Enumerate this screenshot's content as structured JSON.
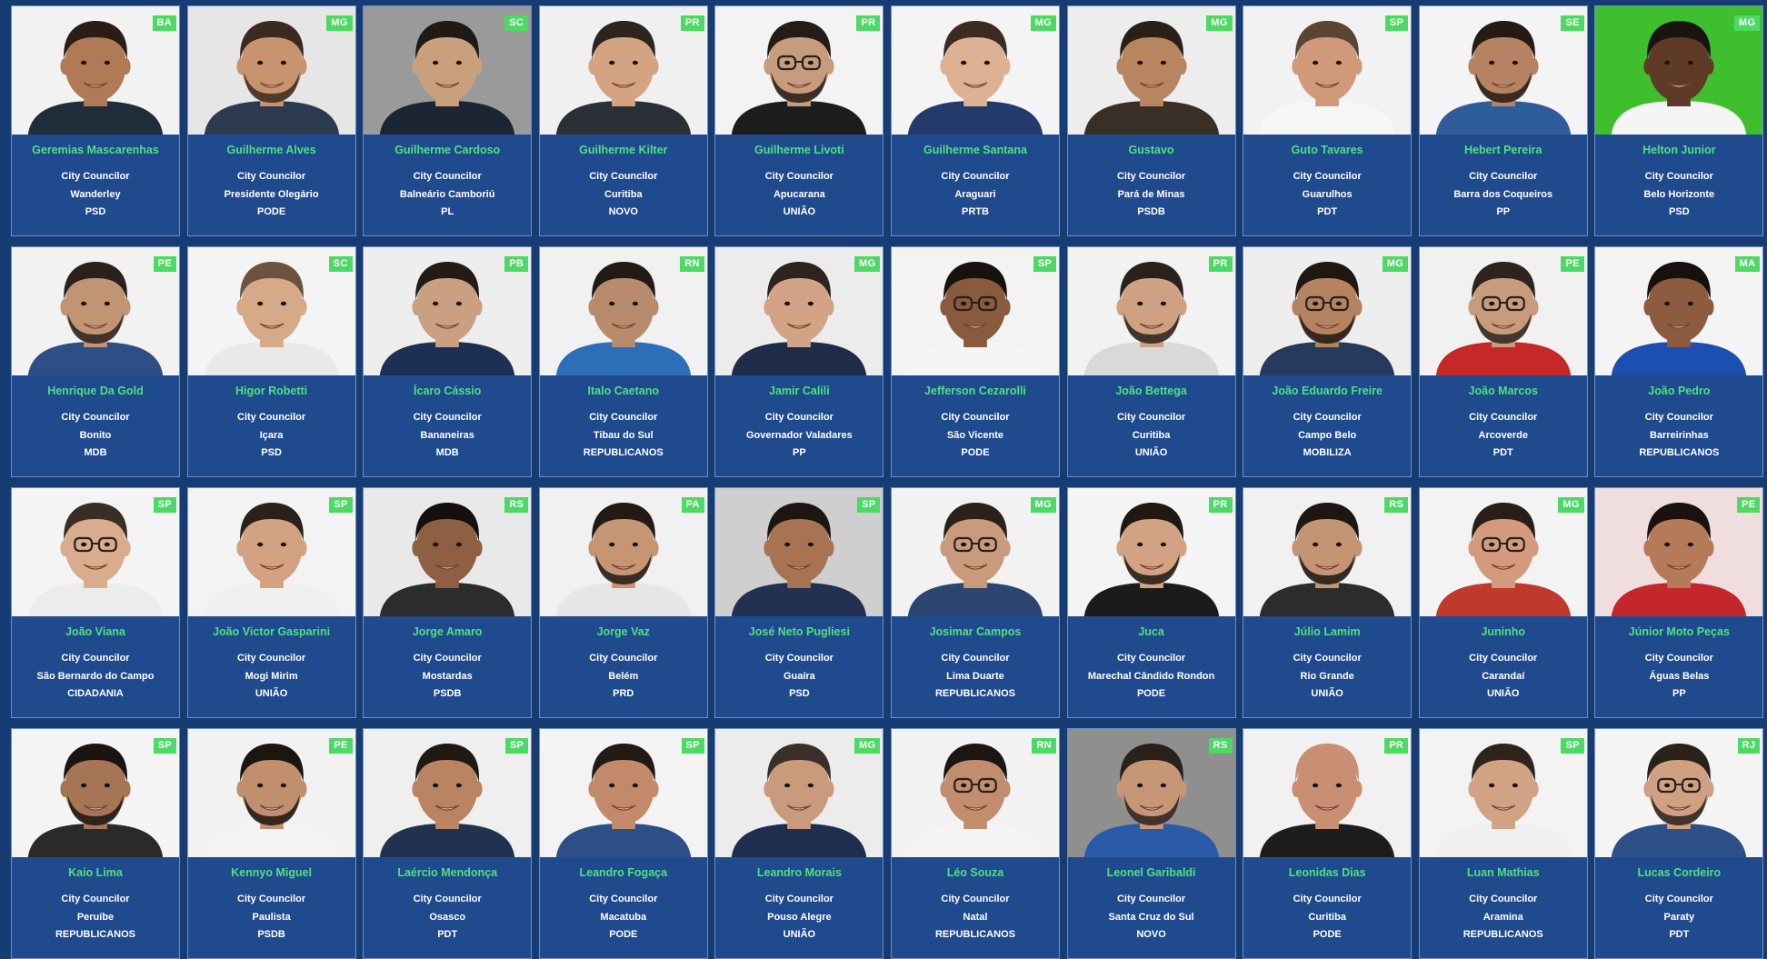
{
  "candidates": [
    {
      "name": "Geremias Mascarenhas",
      "state": "BA",
      "role": "City Councilor",
      "city": "Wanderley",
      "party": "PSD",
      "skin": "#b07a56",
      "hair": "#2a1d15",
      "bg": "#f2f2f2",
      "shirt": "#1f2c3a",
      "glasses": false,
      "beard": false
    },
    {
      "name": "Guilherme Alves",
      "state": "MG",
      "role": "City Councilor",
      "city": "Presidente Olegário",
      "party": "PODE",
      "skin": "#c89470",
      "hair": "#3a2a1f",
      "bg": "#e6e6e6",
      "shirt": "#2b3a4f",
      "glasses": false,
      "beard": true
    },
    {
      "name": "Guilherme Cardoso",
      "state": "SC",
      "role": "City Councilor",
      "city": "Balneário Camboriú",
      "party": "PL",
      "skin": "#c9a07e",
      "hair": "#1f1a16",
      "bg": "#9a9a9a",
      "shirt": "#1b2533",
      "glasses": false,
      "beard": false
    },
    {
      "name": "Guilherme Kilter",
      "state": "PR",
      "role": "City Councilor",
      "city": "Curitiba",
      "party": "NOVO",
      "skin": "#d4a482",
      "hair": "#2c241e",
      "bg": "#f0f0f0",
      "shirt": "#2a2f38",
      "glasses": false,
      "beard": false
    },
    {
      "name": "Guilherme Livoti",
      "state": "PR",
      "role": "City Councilor",
      "city": "Apucarana",
      "party": "UNIÃO",
      "skin": "#c79c7c",
      "hair": "#241c17",
      "bg": "#f3f3f3",
      "shirt": "#1c1c1c",
      "glasses": true,
      "beard": true
    },
    {
      "name": "Guilherme Santana",
      "state": "MG",
      "role": "City Councilor",
      "city": "Araguari",
      "party": "PRTB",
      "skin": "#ddb193",
      "hair": "#3b2b20",
      "bg": "#f4f4f4",
      "shirt": "#233b6b",
      "glasses": false,
      "beard": false
    },
    {
      "name": "Gustavo",
      "state": "MG",
      "role": "City Councilor",
      "city": "Pará de Minas",
      "party": "PSDB",
      "skin": "#b88561",
      "hair": "#2a2018",
      "bg": "#ededed",
      "shirt": "#3a2f27",
      "glasses": false,
      "beard": false
    },
    {
      "name": "Guto Tavares",
      "state": "SP",
      "role": "City Councilor",
      "city": "Guarulhos",
      "party": "PDT",
      "skin": "#d09a7a",
      "hair": "#5a4535",
      "bg": "#f2f2f2",
      "shirt": "#f7f7f7",
      "glasses": false,
      "beard": false
    },
    {
      "name": "Hebert Pereira",
      "state": "SE",
      "role": "City Councilor",
      "city": "Barra dos Coqueiros",
      "party": "PP",
      "skin": "#b58363",
      "hair": "#251b14",
      "bg": "#f4f4f4",
      "shirt": "#2f5d9c",
      "glasses": false,
      "beard": true
    },
    {
      "name": "Helton Junior",
      "state": "MG",
      "role": "City Councilor",
      "city": "Belo Horizonte",
      "party": "PSD",
      "skin": "#5f3a26",
      "hair": "#1a1411",
      "bg": "#3fbf2e",
      "shirt": "#f5f5f5",
      "glasses": false,
      "beard": false
    },
    {
      "name": "Henrique Da Gold",
      "state": "PE",
      "role": "City Councilor",
      "city": "Bonito",
      "party": "MDB",
      "skin": "#c19474",
      "hair": "#2c211a",
      "bg": "#f2f2f2",
      "shirt": "#2f4e86",
      "glasses": false,
      "beard": true
    },
    {
      "name": "Higor Robetti",
      "state": "SC",
      "role": "City Councilor",
      "city": "Içara",
      "party": "PSD",
      "skin": "#d6a988",
      "hair": "#6b5340",
      "bg": "#f4f4f4",
      "shirt": "#e9e9e9",
      "glasses": false,
      "beard": false
    },
    {
      "name": "Ícaro Cássio",
      "state": "PB",
      "role": "City Councilor",
      "city": "Bananeiras",
      "party": "MDB",
      "skin": "#caa083",
      "hair": "#241b15",
      "bg": "#eeeeee",
      "shirt": "#1d2f55",
      "glasses": false,
      "beard": false
    },
    {
      "name": "Italo Caetano",
      "state": "RN",
      "role": "City Councilor",
      "city": "Tibau do Sul",
      "party": "REPUBLICANOS",
      "skin": "#b88b6c",
      "hair": "#211a15",
      "bg": "#f1f1f1",
      "shirt": "#2c6eb8",
      "glasses": false,
      "beard": false
    },
    {
      "name": "Jamir Calili",
      "state": "MG",
      "role": "City Councilor",
      "city": "Governador Valadares",
      "party": "PP",
      "skin": "#d2a384",
      "hair": "#2f241d",
      "bg": "#ececec",
      "shirt": "#1e2c48",
      "glasses": false,
      "beard": false
    },
    {
      "name": "Jefferson Cezarolli",
      "state": "SP",
      "role": "City Councilor",
      "city": "São Vicente",
      "party": "PODE",
      "skin": "#8a5a3d",
      "hair": "#18120f",
      "bg": "#f3f3f3",
      "shirt": "#f5f5f5",
      "glasses": true,
      "beard": false
    },
    {
      "name": "João Bettega",
      "state": "PR",
      "role": "City Councilor",
      "city": "Curitiba",
      "party": "UNIÃO",
      "skin": "#cfa183",
      "hair": "#2a211b",
      "bg": "#f2f2f2",
      "shirt": "#d9d9d9",
      "glasses": false,
      "beard": true
    },
    {
      "name": "João Eduardo Freire",
      "state": "MG",
      "role": "City Councilor",
      "city": "Campo Belo",
      "party": "MOBILIZA",
      "skin": "#b68361",
      "hair": "#1e1712",
      "bg": "#eeeeee",
      "shirt": "#263a5e",
      "glasses": true,
      "beard": true
    },
    {
      "name": "João Marcos",
      "state": "PE",
      "role": "City Councilor",
      "city": "Arcoverde",
      "party": "PDT",
      "skin": "#c89b7d",
      "hair": "#2e241d",
      "bg": "#f1f1f1",
      "shirt": "#c62828",
      "glasses": true,
      "beard": true
    },
    {
      "name": "João Pedro",
      "state": "MA",
      "role": "City Councilor",
      "city": "Barreirinhas",
      "party": "REPUBLICANOS",
      "skin": "#8d5c40",
      "hair": "#17110e",
      "bg": "#f4f4f4",
      "shirt": "#1d4fb0",
      "glasses": false,
      "beard": false
    },
    {
      "name": "João Viana",
      "state": "SP",
      "role": "City Councilor",
      "city": "São Bernardo do Campo",
      "party": "CIDADANIA",
      "skin": "#d8ac8d",
      "hair": "#3a2d23",
      "bg": "#f4f4f4",
      "shirt": "#ececec",
      "glasses": true,
      "beard": false
    },
    {
      "name": "João Victor Gasparini",
      "state": "SP",
      "role": "City Councilor",
      "city": "Mogi Mirim",
      "party": "UNIÃO",
      "skin": "#d3a282",
      "hair": "#2b211a",
      "bg": "#f3f3f3",
      "shirt": "#f0f0f0",
      "glasses": false,
      "beard": false
    },
    {
      "name": "Jorge Amaro",
      "state": "RS",
      "role": "City Councilor",
      "city": "Mostardas",
      "party": "PSDB",
      "skin": "#8e5f43",
      "hair": "#15100d",
      "bg": "#e9e9e9",
      "shirt": "#2c2c2c",
      "glasses": false,
      "beard": false
    },
    {
      "name": "Jorge Vaz",
      "state": "PA",
      "role": "City Councilor",
      "city": "Belém",
      "party": "PRD",
      "skin": "#c69574",
      "hair": "#221a14",
      "bg": "#f1f1f1",
      "shirt": "#e6e6e6",
      "glasses": false,
      "beard": true
    },
    {
      "name": "José Neto Pugliesi",
      "state": "SP",
      "role": "City Councilor",
      "city": "Guaíra",
      "party": "PSD",
      "skin": "#a87352",
      "hair": "#1c1511",
      "bg": "#cfcfcf",
      "shirt": "#22314f",
      "glasses": false,
      "beard": false
    },
    {
      "name": "Josimar Campos",
      "state": "MG",
      "role": "City Councilor",
      "city": "Lima Duarte",
      "party": "REPUBLICANOS",
      "skin": "#c99a7b",
      "hair": "#2a211a",
      "bg": "#f2f2f2",
      "shirt": "#2b4670",
      "glasses": true,
      "beard": false
    },
    {
      "name": "Juca",
      "state": "PR",
      "role": "City Councilor",
      "city": "Marechal Cândido Rondon",
      "party": "PODE",
      "skin": "#d1a384",
      "hair": "#1f1813",
      "bg": "#f4f4f4",
      "shirt": "#1b1b1b",
      "glasses": false,
      "beard": true
    },
    {
      "name": "Júlio Lamim",
      "state": "RS",
      "role": "City Councilor",
      "city": "Rio Grande",
      "party": "UNIÃO",
      "skin": "#c49575",
      "hair": "#1d1612",
      "bg": "#f1f1f1",
      "shirt": "#2c2c2c",
      "glasses": false,
      "beard": true
    },
    {
      "name": "Juninho",
      "state": "MG",
      "role": "City Councilor",
      "city": "Carandaí",
      "party": "UNIÃO",
      "skin": "#d39b7c",
      "hair": "#2a1f18",
      "bg": "#f3f3f3",
      "shirt": "#c0392b",
      "glasses": true,
      "beard": false
    },
    {
      "name": "Júnior Moto Peças",
      "state": "PE",
      "role": "City Councilor",
      "city": "Águas Belas",
      "party": "PP",
      "skin": "#b57a58",
      "hair": "#19120e",
      "bg": "#f0dede",
      "shirt": "#c3262c",
      "glasses": false,
      "beard": false
    },
    {
      "name": "Kaio Lima",
      "state": "SP",
      "role": "City Councilor",
      "city": "Peruíbe",
      "party": "REPUBLICANOS",
      "skin": "#a67556",
      "hair": "#1b1410",
      "bg": "#f4f4f4",
      "shirt": "#2a2a2a",
      "glasses": false,
      "beard": true
    },
    {
      "name": "Kennyo Miguel",
      "state": "PE",
      "role": "City Councilor",
      "city": "Paulista",
      "party": "PSDB",
      "skin": "#c28f6e",
      "hair": "#1c1510",
      "bg": "#f2f2f2",
      "shirt": "#f3f3f3",
      "glasses": false,
      "beard": true
    },
    {
      "name": "Laércio Mendonça",
      "state": "SP",
      "role": "City Councilor",
      "city": "Osasco",
      "party": "PDT",
      "skin": "#b88462",
      "hair": "#1f1813",
      "bg": "#efefef",
      "shirt": "#20324f",
      "glasses": false,
      "beard": false
    },
    {
      "name": "Leandro Fogaça",
      "state": "SP",
      "role": "City Councilor",
      "city": "Macatuba",
      "party": "PODE",
      "skin": "#c28a6a",
      "hair": "#221a14",
      "bg": "#f3f3f3",
      "shirt": "#2d4e86",
      "glasses": false,
      "beard": false
    },
    {
      "name": "Leandro Morais",
      "state": "MG",
      "role": "City Councilor",
      "city": "Pouso Alegre",
      "party": "UNIÃO",
      "skin": "#c99b7c",
      "hair": "#3b3029",
      "bg": "#ececec",
      "shirt": "#1f2e4e",
      "glasses": false,
      "beard": false
    },
    {
      "name": "Léo Souza",
      "state": "RN",
      "role": "City Councilor",
      "city": "Natal",
      "party": "REPUBLICANOS",
      "skin": "#c08e6d",
      "hair": "#1c1511",
      "bg": "#f2f2f2",
      "shirt": "#f4f4f4",
      "glasses": true,
      "beard": false
    },
    {
      "name": "Leonel Garibaldi",
      "state": "RS",
      "role": "City Councilor",
      "city": "Santa Cruz do Sul",
      "party": "NOVO",
      "skin": "#c69677",
      "hair": "#2a211b",
      "bg": "#8f8f8f",
      "shirt": "#2b5aa8",
      "glasses": false,
      "beard": true
    },
    {
      "name": "Leonidas Dias",
      "state": "PR",
      "role": "City Councilor",
      "city": "Curitiba",
      "party": "PODE",
      "skin": "#c98f72",
      "hair": "#c98f72",
      "bg": "#f1f1f1",
      "shirt": "#1d1d1d",
      "glasses": false,
      "beard": false
    },
    {
      "name": "Luan Mathias",
      "state": "SP",
      "role": "City Councilor",
      "city": "Aramina",
      "party": "REPUBLICANOS",
      "skin": "#d1a284",
      "hair": "#2f241c",
      "bg": "#f3f3f3",
      "shirt": "#f0f0f0",
      "glasses": false,
      "beard": false
    },
    {
      "name": "Lucas Cordeiro",
      "state": "RJ",
      "role": "City Councilor",
      "city": "Paraty",
      "party": "PDT",
      "skin": "#d0a083",
      "hair": "#2a211a",
      "bg": "#f4f4f4",
      "shirt": "#2d4f8a",
      "glasses": true,
      "beard": true
    }
  ]
}
